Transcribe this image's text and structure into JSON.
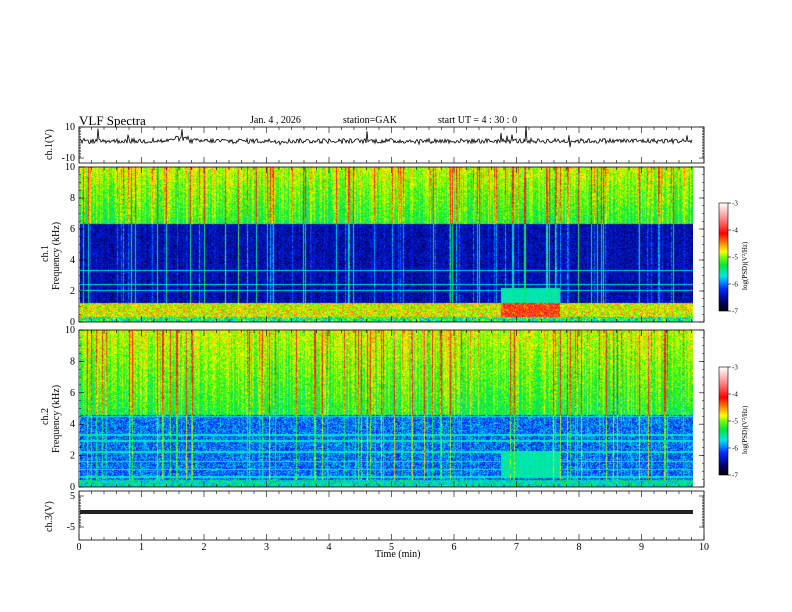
{
  "header": {
    "title": "VLF  Spectra",
    "date": "Jan. 4  , 2026",
    "station": "station=GAK",
    "start_ut": "start  UT =   4  : 30 : 0"
  },
  "chart_data": [
    {
      "type": "line",
      "panel": "ch.1 waveform",
      "ylabel": "ch.1(V)",
      "ylim": [
        -10,
        10
      ],
      "yticks": [
        "10",
        "-10"
      ],
      "xlim": [
        0,
        10
      ],
      "color": "#000000",
      "description_of_values": "noisy signal around 0 V spanning 0 to 9.8 min"
    },
    {
      "type": "heatmap",
      "panel": "ch.1 spectrogram",
      "ylabel": "ch.1\nFrequency  (kHz)",
      "ylabel_line1": "ch.1",
      "ylabel_line2": "Frequency  (kHz)",
      "ylim": [
        0,
        10
      ],
      "yticks": [
        "0",
        "2",
        "4",
        "6",
        "8",
        "10"
      ],
      "xlim": [
        0,
        10
      ],
      "colorbar": {
        "label": "log(PSD)(V²/Hz)",
        "range": [
          -7,
          -3
        ],
        "ticks": [
          "-3",
          "-4",
          "-5",
          "-6",
          "-7"
        ]
      }
    },
    {
      "type": "heatmap",
      "panel": "ch.2 spectrogram",
      "ylabel_line1": "ch.2",
      "ylabel_line2": "Frequency  (kHz)",
      "ylim": [
        0,
        10
      ],
      "yticks": [
        "0",
        "2",
        "4",
        "6",
        "8",
        "10"
      ],
      "xlim": [
        0,
        10
      ],
      "colorbar": {
        "label": "log(PSD)(V²/Hz)",
        "range": [
          -7,
          -3
        ],
        "ticks": [
          "-3",
          "-4",
          "-5",
          "-6",
          "-7"
        ]
      }
    },
    {
      "type": "line",
      "panel": "ch.3 waveform",
      "ylabel": "ch.3(V)",
      "ylim": [
        -5,
        5
      ],
      "yticks": [
        "5",
        "-5"
      ],
      "xlim": [
        0,
        10
      ],
      "values_constant": 0,
      "color": "#000000"
    }
  ],
  "xaxis": {
    "label": "Time  (min)",
    "ticks": [
      "0",
      "1",
      "2",
      "3",
      "4",
      "5",
      "6",
      "7",
      "8",
      "9",
      "10"
    ]
  },
  "colorbar_label": "log(PSD)(V²/Hz)"
}
